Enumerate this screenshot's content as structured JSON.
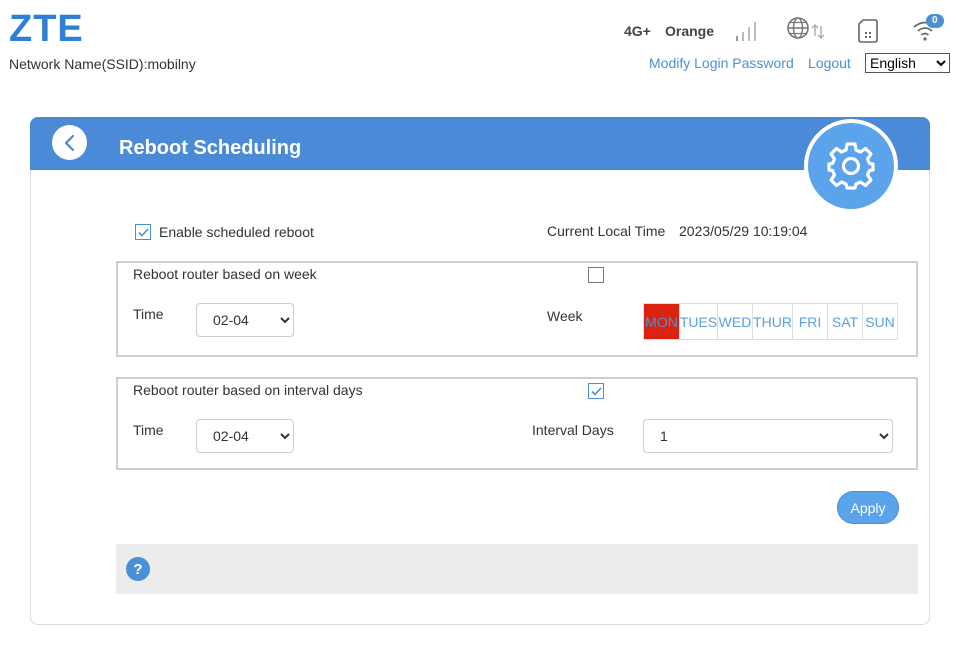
{
  "header": {
    "logo": "ZTE",
    "ssid": "Network Name(SSID):mobilny",
    "network_type": "4G+",
    "carrier": "Orange",
    "wifi_clients": "0",
    "modify_password": "Modify Login Password",
    "logout": "Logout",
    "language": {
      "selected": "English",
      "options": [
        "English"
      ]
    }
  },
  "page": {
    "title": "Reboot Scheduling",
    "enable_label": "Enable scheduled reboot",
    "enable_checked": true,
    "current_time_label": "Current Local Time",
    "current_time_value": "2023/05/29 10:19:04"
  },
  "week_section": {
    "title": "Reboot router based on week",
    "checked": false,
    "time_label": "Time",
    "time_value": "02-04",
    "week_label": "Week",
    "days": [
      {
        "label": "MON",
        "active": true
      },
      {
        "label": "TUES",
        "active": false
      },
      {
        "label": "WED",
        "active": false
      },
      {
        "label": "THUR",
        "active": false
      },
      {
        "label": "FRI",
        "active": false
      },
      {
        "label": "SAT",
        "active": false
      },
      {
        "label": "SUN",
        "active": false
      }
    ]
  },
  "interval_section": {
    "title": "Reboot router based on interval days",
    "checked": true,
    "time_label": "Time",
    "time_value": "02-04",
    "interval_label": "Interval Days",
    "interval_value": "1"
  },
  "actions": {
    "apply": "Apply",
    "help": "?"
  },
  "colors": {
    "accent": "#4a8ad6",
    "link": "#4a90d9",
    "active_day": "#d9230f"
  }
}
